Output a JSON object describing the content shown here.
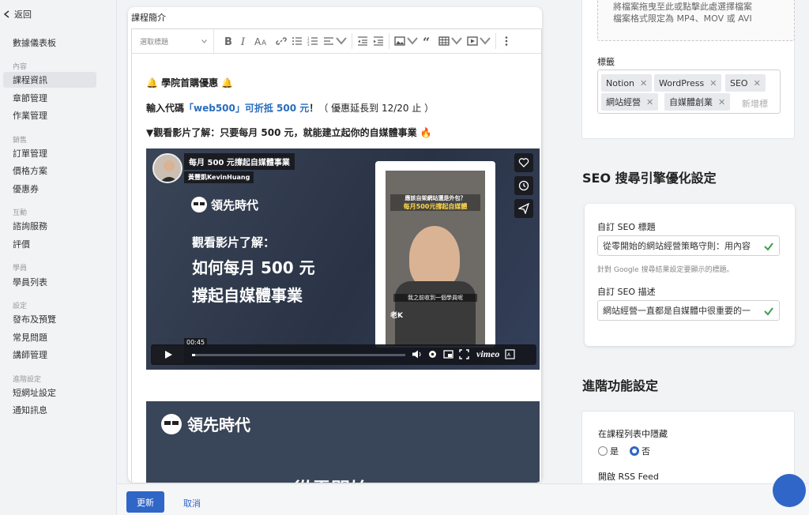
{
  "sidebar": {
    "back_label": "返回",
    "dashboard": "數據儀表板",
    "sections": [
      {
        "heading": "內容",
        "items": [
          "課程資訊",
          "章節管理",
          "作業管理"
        ]
      },
      {
        "heading": "銷售",
        "items": [
          "訂單管理",
          "價格方案",
          "優惠券"
        ]
      },
      {
        "heading": "互動",
        "items": [
          "諮詢服務",
          "評價"
        ]
      },
      {
        "heading": "學員",
        "items": [
          "學員列表"
        ]
      },
      {
        "heading": "設定",
        "items": [
          "發布及預覽",
          "常見問題",
          "講師管理"
        ]
      },
      {
        "heading": "進階設定",
        "items": [
          "短網址設定",
          "通知訊息"
        ]
      }
    ],
    "active_item": "課程資訊"
  },
  "editor": {
    "label": "課程簡介",
    "toolbar": {
      "heading_select": "選取標題"
    },
    "content": {
      "line1": "🔔 學院首購優惠 🔔",
      "line2_prefix": "輸入代碼",
      "line2_link": "「web500」可折抵 500 元",
      "line2_mid": "！",
      "line2_note": "（ 優惠延長到 12/20 止 ）",
      "line3": "▼觀看影片了解：只要每月 500 元，就能建立起你的自媒體事業 🔥"
    },
    "video": {
      "title": "每月 500 元撐起自媒體事業",
      "author": "黃豐凱KevinHuang",
      "brand": "領先時代",
      "line1": "觀看影片了解：",
      "line2": "如何每月 500 元",
      "line3": "撐起自媒體事業",
      "phone_caption1": "應該自架網站還是外包？",
      "phone_caption2": "每月500元撐起自媒體",
      "phone_subtitle": "我之前收到一個學員呢",
      "phone_logo": "老K",
      "timestamp": "00:45",
      "progress": 0.016,
      "player_brand": "vimeo"
    },
    "image2": {
      "brand": "領先時代",
      "text": "從零開始"
    }
  },
  "bottom": {
    "update_label": "更新",
    "cancel_label": "取消"
  },
  "right": {
    "upload_text1": "將檔案拖曳至此或點擊此處選擇檔案",
    "upload_text2": "檔案格式限定為 MP4、MOV 或 AVI",
    "tags_label": "標籤",
    "tags": [
      "Notion",
      "WordPress",
      "SEO",
      "網站經營",
      "自媒體創業"
    ],
    "tag_placeholder": "新增標",
    "seo_heading": "SEO 搜尋引擎優化設定",
    "seo_title_label": "自訂 SEO 標題",
    "seo_title_value": "從零開始的網站經營策略守則：用內容",
    "seo_title_help": "針對 Google 搜尋結果設定要顯示的標題。",
    "seo_desc_label": "自訂 SEO 描述",
    "seo_desc_value": "網站經營一直都是自媒體中很重要的一",
    "adv_heading": "進階功能設定",
    "hide_label": "在課程列表中隱藏",
    "radio_yes": "是",
    "radio_no": "否",
    "radio_selected": "否",
    "rss_label": "開啟 RSS Feed"
  },
  "colors": {
    "accent": "#2f66c7",
    "link": "#2a6dbb",
    "check": "#3aa04a"
  }
}
